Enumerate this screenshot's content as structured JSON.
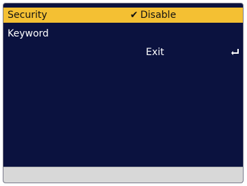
{
  "menu": {
    "security_label": "Security",
    "security_value": "Disable",
    "keyword_label": "Keyword",
    "exit_label": "Exit"
  },
  "icons": {
    "selected_indicator": "check-icon",
    "exit_indicator": "enter-icon"
  },
  "colors": {
    "background": "#0b123f",
    "selection": "#f4c033",
    "text": "#ffffff",
    "status_bar": "#d8d8d8"
  }
}
